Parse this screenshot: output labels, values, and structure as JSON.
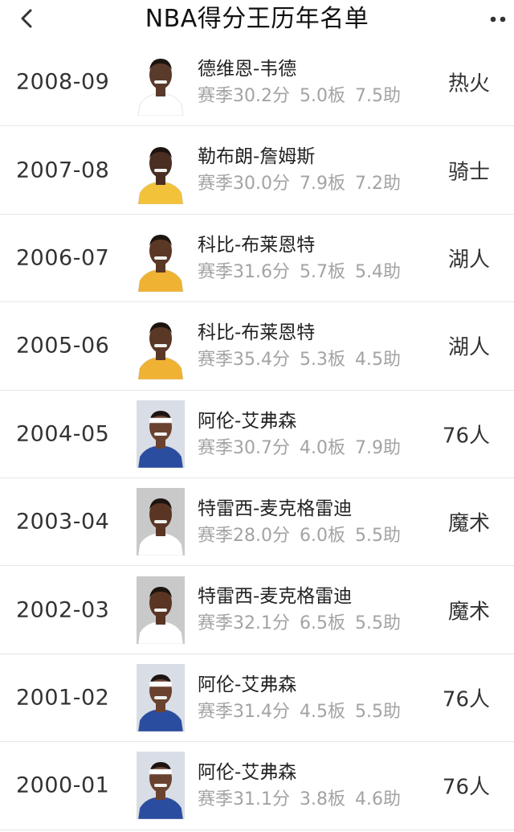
{
  "header": {
    "title": "NBA得分王历年名单",
    "back_icon": "chevron-left-icon",
    "more_icon": "more-dots-icon"
  },
  "rows": [
    {
      "season": "2008-09",
      "name": "德维恩-韦德",
      "points": "赛季30.2分",
      "rebounds": "5.0板",
      "assists": "7.5助",
      "team": "热火",
      "avatar": {
        "bg": "#ffffff",
        "jersey": "#ffffff",
        "skin": "#5a3a2a",
        "headband": false
      }
    },
    {
      "season": "2007-08",
      "name": "勒布朗-詹姆斯",
      "points": "赛季30.0分",
      "rebounds": "7.9板",
      "assists": "7.2助",
      "team": "骑士",
      "avatar": {
        "bg": "#ffffff",
        "jersey": "#f2c23a",
        "skin": "#4a2e22",
        "headband": false
      }
    },
    {
      "season": "2006-07",
      "name": "科比-布莱恩特",
      "points": "赛季31.6分",
      "rebounds": "5.7板",
      "assists": "5.4助",
      "team": "湖人",
      "avatar": {
        "bg": "#ffffff",
        "jersey": "#f0b232",
        "skin": "#5b3826",
        "headband": false
      }
    },
    {
      "season": "2005-06",
      "name": "科比-布莱恩特",
      "points": "赛季35.4分",
      "rebounds": "5.3板",
      "assists": "4.5助",
      "team": "湖人",
      "avatar": {
        "bg": "#ffffff",
        "jersey": "#f0b232",
        "skin": "#5b3826",
        "headband": false
      }
    },
    {
      "season": "2004-05",
      "name": "阿伦-艾弗森",
      "points": "赛季30.7分",
      "rebounds": "4.0板",
      "assists": "7.9助",
      "team": "76人",
      "avatar": {
        "bg": "#d9dde6",
        "jersey": "#2a4da0",
        "skin": "#6a4230",
        "headband": true
      }
    },
    {
      "season": "2003-04",
      "name": "特雷西-麦克格雷迪",
      "points": "赛季28.0分",
      "rebounds": "6.0板",
      "assists": "5.5助",
      "team": "魔术",
      "avatar": {
        "bg": "#c9c9c9",
        "jersey": "#ffffff",
        "skin": "#5a3524",
        "headband": false
      }
    },
    {
      "season": "2002-03",
      "name": "特雷西-麦克格雷迪",
      "points": "赛季32.1分",
      "rebounds": "6.5板",
      "assists": "5.5助",
      "team": "魔术",
      "avatar": {
        "bg": "#c9c9c9",
        "jersey": "#ffffff",
        "skin": "#5a3524",
        "headband": false
      }
    },
    {
      "season": "2001-02",
      "name": "阿伦-艾弗森",
      "points": "赛季31.4分",
      "rebounds": "4.5板",
      "assists": "5.5助",
      "team": "76人",
      "avatar": {
        "bg": "#d9dde6",
        "jersey": "#2a4da0",
        "skin": "#6a4230",
        "headband": true
      }
    },
    {
      "season": "2000-01",
      "name": "阿伦-艾弗森",
      "points": "赛季31.1分",
      "rebounds": "3.8板",
      "assists": "4.6助",
      "team": "76人",
      "avatar": {
        "bg": "#d9dde6",
        "jersey": "#2a4da0",
        "skin": "#6a4230",
        "headband": true
      }
    }
  ]
}
